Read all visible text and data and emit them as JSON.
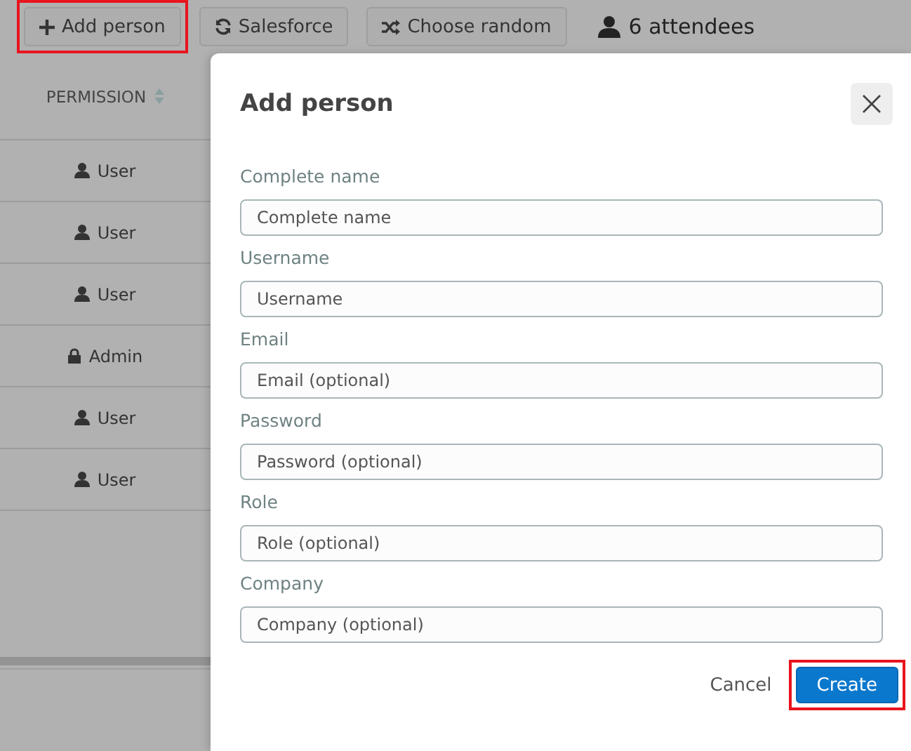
{
  "toolbar": {
    "buttons": [
      {
        "label": "Add person",
        "kind": "plus",
        "highlighted": true
      },
      {
        "label": "Salesforce",
        "kind": "sync",
        "highlighted": false
      },
      {
        "label": "Choose random",
        "kind": "shuffle",
        "highlighted": false
      }
    ],
    "attendees": "6 attendees"
  },
  "table": {
    "columns": [
      "PERMISSION"
    ],
    "rows": [
      {
        "permission": "User",
        "kind": "user"
      },
      {
        "permission": "User",
        "kind": "user"
      },
      {
        "permission": "User",
        "kind": "user"
      },
      {
        "permission": "Admin",
        "kind": "admin"
      },
      {
        "permission": "User",
        "kind": "user"
      },
      {
        "permission": "User",
        "kind": "user"
      }
    ]
  },
  "dialog": {
    "title": "Add person",
    "fields": [
      {
        "label": "Complete name",
        "placeholder": "Complete name"
      },
      {
        "label": "Username",
        "placeholder": "Username"
      },
      {
        "label": "Email",
        "placeholder": "Email (optional)"
      },
      {
        "label": "Password",
        "placeholder": "Password (optional)"
      },
      {
        "label": "Role",
        "placeholder": "Role (optional)"
      },
      {
        "label": "Company",
        "placeholder": "Company (optional)"
      }
    ],
    "cancel": "Cancel",
    "create": {
      "label": "Create",
      "highlighted": true
    }
  }
}
